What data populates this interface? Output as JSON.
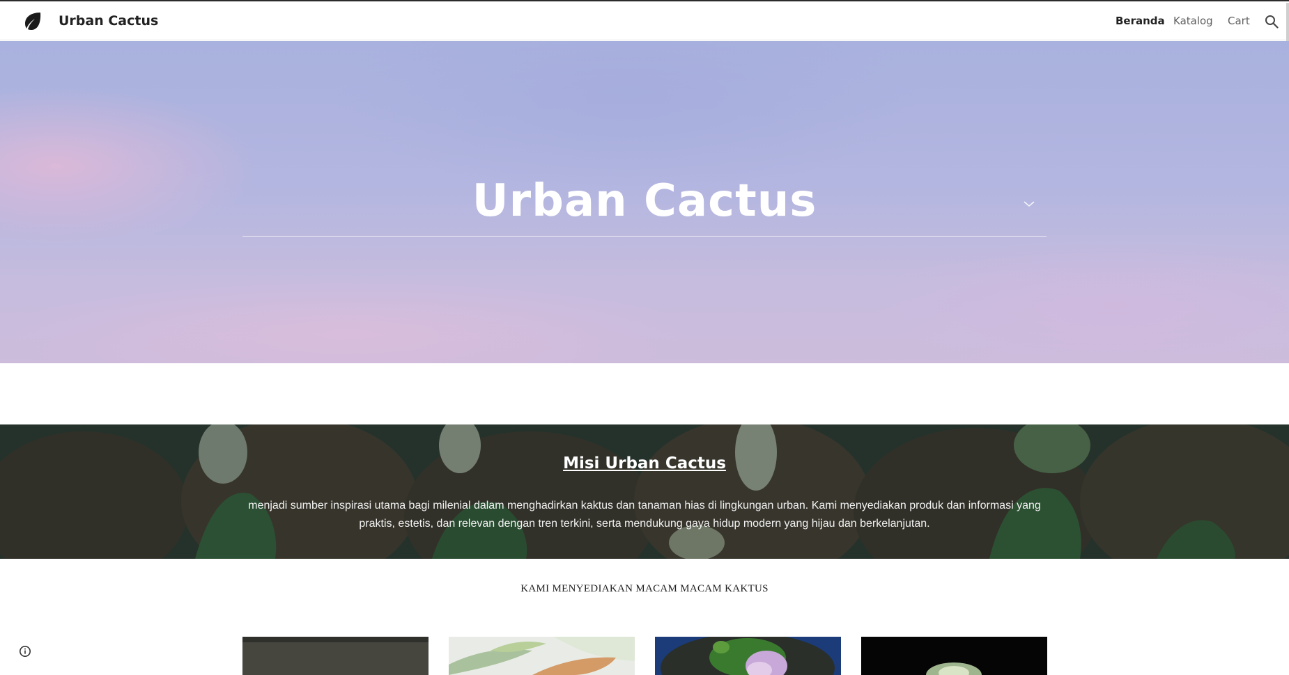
{
  "header": {
    "site_name": "Urban Cactus",
    "logo_icon": "leaf-icon",
    "nav": [
      {
        "label": "Beranda",
        "active": true
      },
      {
        "label": "Katalog",
        "active": false
      },
      {
        "label": "Cart",
        "active": false
      }
    ],
    "search_icon": "search-icon"
  },
  "hero": {
    "title": "Urban Cactus",
    "scroll_icon": "chevron-down-icon"
  },
  "mission": {
    "title": "Misi Urban Cactus",
    "text": "menjadi sumber inspirasi utama bagi milenial dalam menghadirkan kaktus dan tanaman hias di lingkungan urban. Kami menyediakan produk dan informasi yang praktis, estetis, dan relevan dengan tren terkini, serta mendukung gaya hidup modern yang hijau dan berkelanjutan."
  },
  "products_section": {
    "heading": "KAMI MENYEDIAKAN MACAM MACAM KAKTUS",
    "cards": 4
  },
  "footer": {
    "info_icon": "info-icon"
  },
  "colors": {
    "accent_text": "#212121",
    "hero_sky": "#aab2de",
    "mission_bg": "#2a3a33"
  }
}
